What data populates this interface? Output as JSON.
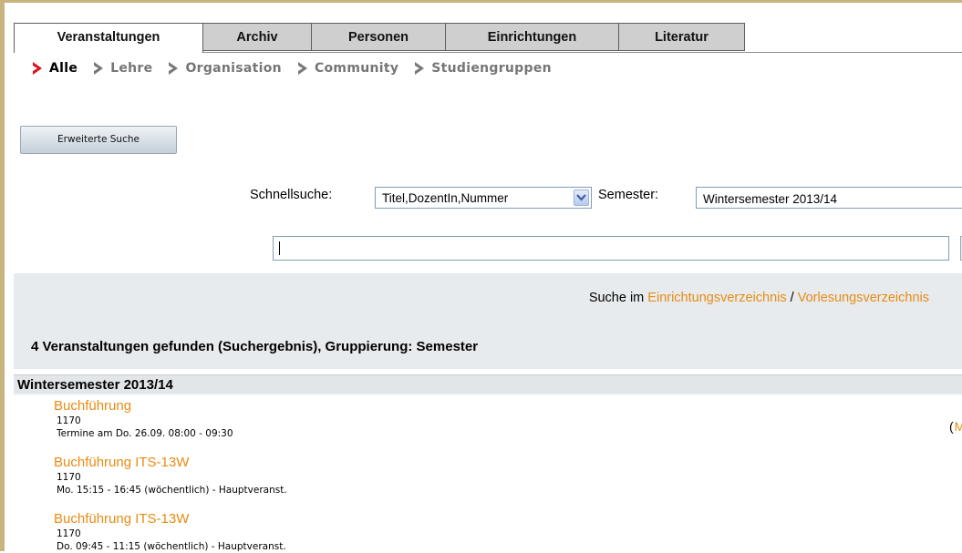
{
  "tabs": [
    {
      "label": "Veranstaltungen",
      "active": true
    },
    {
      "label": "Archiv",
      "active": false
    },
    {
      "label": "Personen",
      "active": false
    },
    {
      "label": "Einrichtungen",
      "active": false
    },
    {
      "label": "Literatur",
      "active": false
    }
  ],
  "subnav": [
    {
      "label": "Alle",
      "active": true
    },
    {
      "label": "Lehre",
      "active": false
    },
    {
      "label": "Organisation",
      "active": false
    },
    {
      "label": "Community",
      "active": false
    },
    {
      "label": "Studiengruppen",
      "active": false
    }
  ],
  "advanced_search": {
    "label": "Erweiterte Suche"
  },
  "quick_search": {
    "label": "Schnellsuche:",
    "selected": "Titel,DozentIn,Nummer",
    "semester_label": "Semester:",
    "semester_value": "Wintersemester 2013/14",
    "query": ""
  },
  "results": {
    "search_prefix": "Suche im ",
    "link_institutions": "Einrichtungsverzeichnis",
    "separator": " / ",
    "link_lectures": "Vorlesungsverzeichnis",
    "found_text": "4 Veranstaltungen gefunden (Suchergebnis), Gruppierung: Semester"
  },
  "group": {
    "title": "Wintersemester 2013/14",
    "courses": [
      {
        "title": "Buchführung",
        "number": "1170",
        "time": "Termine am Do. 26.09. 08:00 - 09:30"
      },
      {
        "title": "Buchführung ITS-13W",
        "number": "1170",
        "time": "Mo. 15:15 - 16:45 (wöchentlich) - Hauptveranst."
      },
      {
        "title": "Buchführung ITS-13W",
        "number": "1170",
        "time": "Do. 09:45 - 11:15 (wöchentlich) - Hauptveranst."
      }
    ],
    "right_paren": "(",
    "right_link": "M"
  },
  "colors": {
    "accent": "#e98b12",
    "chevron_active": "#d8141c",
    "chevron_inactive": "#777777"
  },
  "icons": {
    "subnav_chevron": "chevron-right-icon",
    "select_arrow": "chevron-down-icon"
  }
}
